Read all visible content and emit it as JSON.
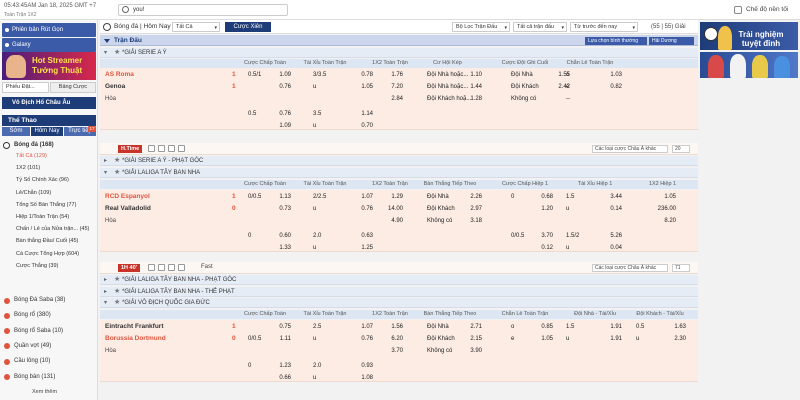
{
  "topbar": {
    "clock": "05:43:45AM Jan 18, 2025 GMT +7",
    "tool_label": "Toàn Trận 1X2",
    "search_value": "you!",
    "dark_mode_label": "Chế độ nền tối"
  },
  "sidebar": {
    "promo1": "Phiên bản Rút Gọn",
    "promo2": "Galaxy",
    "hot_banner": "Hot Streamer Tưởng Thuật",
    "tabs1": [
      "Phiếu Đặt...",
      "Bảng Cược"
    ],
    "euro": "Vô Địch Hổ Châu Âu",
    "sport_header": "Thể Thao",
    "tabs2": [
      "Sớm",
      "Hôm Nay",
      "Trực tiếp"
    ],
    "tab_badge": "17",
    "football": "Bóng đá (168)",
    "football_sub": [
      "Tất Cả (129)",
      "1X2 (101)",
      "Tỷ Số Chính Xác (96)",
      "Lẻ/Chẵn (109)",
      "Tổng Số Bàn Thắng (77)",
      "Hiệp 1/Toàn Trận (54)",
      "Chấn / Lẻ của Nửa trận... (45)",
      "Bàn thắng Đầu/ Cuối (45)",
      "Cá Cược Tổng Hợp (604)",
      "Cược Thắng (39)"
    ],
    "sports": [
      "Bóng Đá Saba (38)",
      "Bóng rổ (380)",
      "Bóng rổ Saba (10)",
      "Quần vợt (49)",
      "Cầu lông (10)",
      "Bóng bàn (131)"
    ],
    "view_more": "Xem thêm"
  },
  "header": {
    "sport": "Bóng đá | Hôm Nay",
    "filter": "Tất Cả",
    "live_button": "Cược Xiên",
    "sort1": "Bộ Lọc Trận Đấu",
    "sort2": "Tất cả trận đấu",
    "sort3": "Từ trước đến nay",
    "count": "(55 | 55) Giải"
  },
  "matches_bar": {
    "title": "Trận Đấu",
    "odds_type": "Lựa chọn bình thường",
    "odds_format": "Hải Dương"
  },
  "leagues": [
    "*GIẢI SERIE A Ý",
    "*GIẢI SERIE A Ý - PHẠT GÓC",
    "*GIẢI LALIGA TÂY BAN NHA",
    "*GIẢI LALIGA TÂY BAN NHA - PHẠT GÓC",
    "*GIẢI LALIGA TÂY BAN NHA - THẺ PHẠT",
    "*GIẢI VÔ ĐỊCH QUỐC GIA ĐỨC"
  ],
  "col_heads": {
    "serie": [
      "Cược Chấp Toàn Trận",
      "Tài Xỉu Toàn Trận",
      "1X2 Toàn Trận",
      "Cơ Hội Kép",
      "Cược Đội Ghi Cuối Cùng",
      "Chẵn Lẻ Toàn Trận"
    ],
    "laliga": [
      "Cược Chấp Toàn Trận",
      "Tài Xỉu Toàn Trận",
      "1X2 Toàn Trận",
      "Bàn Thắng Tiếp Theo",
      "Cược Chấp Hiệp 1",
      "Tài Xỉu Hiệp 1",
      "1X2 Hiệp 1"
    ],
    "bund": [
      "Cược Chấp Toàn Trận",
      "Tài Xỉu Toàn Trận",
      "1X2 Toàn Trận",
      "Bàn Thắng Tiếp Theo",
      "Chẵn Lẻ Toàn Trận",
      "Đội Nhà - Tài/Xỉu",
      "Đội Khách - Tài/Xỉu"
    ]
  },
  "match1": {
    "home": "AS Roma",
    "away": "Genoa",
    "draw": "Hòa",
    "home_score": "1",
    "away_score": "1",
    "r1": [
      "0.5/1",
      "1.09",
      "3/3.5",
      "0.78",
      "1.76",
      "Đội Nhà hoặc...",
      "1.10",
      "Đội Nhà",
      "1.55",
      "o",
      "1.03"
    ],
    "r2": [
      "",
      "0.76",
      "u",
      "1.05",
      "7.20",
      "Đội Nhà hoặc...",
      "1.44",
      "Đội Khách",
      "2.42",
      "e",
      "0.82"
    ],
    "r3": [
      "",
      "",
      "",
      "",
      "2.84",
      "Đội Khách hoặ...",
      "1.28",
      "Không có",
      "--"
    ],
    "r4": [
      "0.5",
      "0.76",
      "3.5",
      "1.14"
    ],
    "r5": [
      "",
      "1.09",
      "u",
      "0.70"
    ]
  },
  "status1": {
    "time": "H.Time",
    "filter": "Các loại cược Châu Á khác",
    "count": "20"
  },
  "match2": {
    "home": "RCD Espanyol",
    "away": "Real Valladolid",
    "draw": "Hòa",
    "home_score": "1",
    "away_score": "0",
    "r1": [
      "0/0.5",
      "1.13",
      "2/2.5",
      "1.07",
      "1.29",
      "Đội Nhà",
      "2.26",
      "0",
      "0.68",
      "1.5",
      "3.44",
      "1.05"
    ],
    "r2": [
      "",
      "0.73",
      "u",
      "0.76",
      "14.00",
      "Đội Khách",
      "2.97",
      "1.20",
      "u",
      "0.14",
      "236.00"
    ],
    "r3": [
      "",
      "",
      "",
      "",
      "4.90",
      "Không có",
      "3.18",
      "",
      "",
      "",
      "8.20"
    ],
    "r4": [
      "0",
      "0.60",
      "2.0",
      "0.63",
      "",
      "",
      "",
      "0/0.5",
      "3.70",
      "1.5/2",
      "5.26"
    ],
    "r5": [
      "",
      "1.33",
      "u",
      "1.25",
      "",
      "",
      "",
      "",
      "0.12",
      "u",
      "0.04"
    ]
  },
  "status2": {
    "time": "1H 40'",
    "fast": "Fast",
    "filter": "Các loại cược Châu Á khác",
    "count": "71"
  },
  "match3": {
    "home": "Eintracht Frankfurt",
    "away": "Borussia Dortmund",
    "draw": "Hòa",
    "home_score": "1",
    "away_score": "0",
    "r1": [
      "",
      "0.75",
      "2.5",
      "1.07",
      "1.56",
      "Đội Nhà",
      "2.71",
      "o",
      "0.85",
      "1.5",
      "1.91",
      "0.5",
      "1.63"
    ],
    "r2": [
      "0/0.5",
      "1.11",
      "u",
      "0.76",
      "6.20",
      "Đội Khách",
      "2.15",
      "e",
      "1.05",
      "u",
      "1.91",
      "u",
      "2.30"
    ],
    "r3": [
      "",
      "",
      "",
      "",
      "3.70",
      "Không có",
      "3.90"
    ],
    "r4": [
      "0",
      "1.23",
      "2.0",
      "0.93"
    ],
    "r5": [
      "",
      "0.66",
      "u",
      "1.08"
    ]
  },
  "ads": {
    "ad1_title": "Trải nghiệm tuyệt đỉnh"
  },
  "colors": {
    "navy": "#1e3c78",
    "accent": "#e0543d",
    "row": "#fdece4",
    "league": "#e6ecf6"
  }
}
